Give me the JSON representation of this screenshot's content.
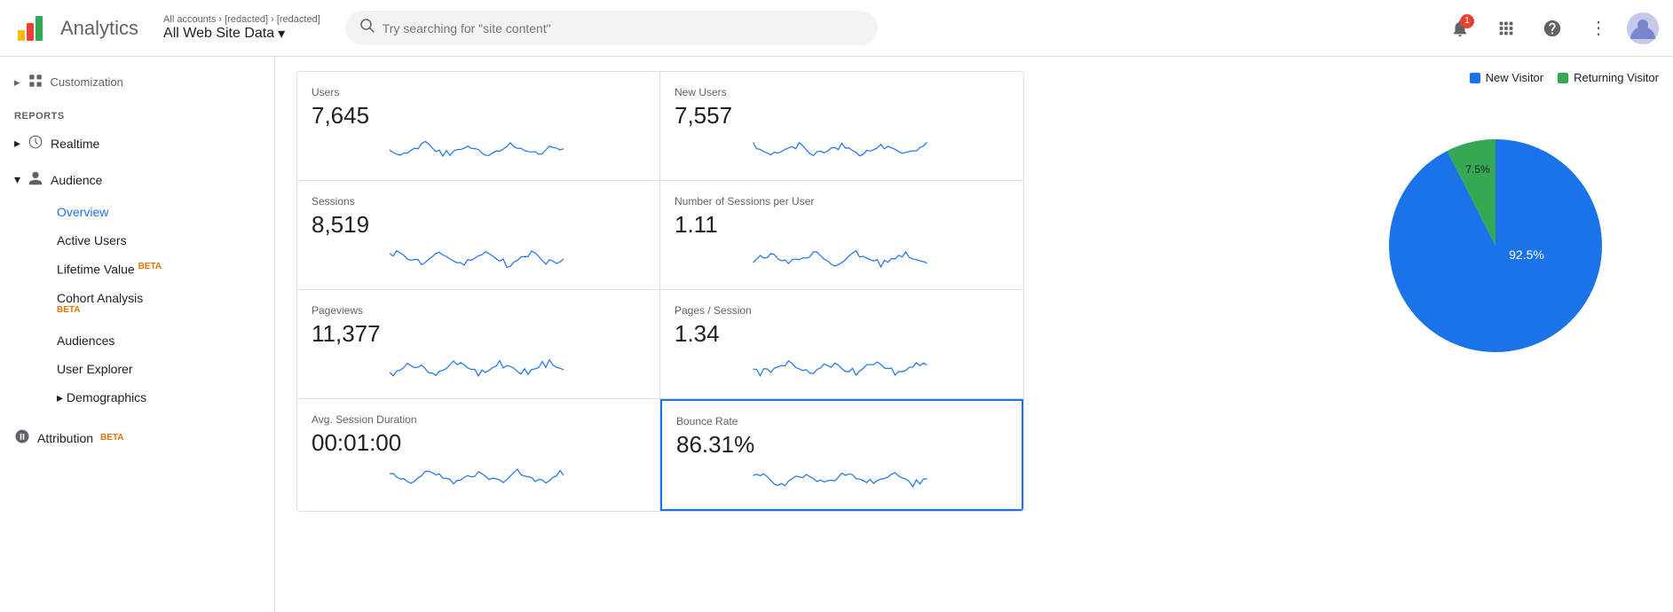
{
  "topbar": {
    "app_name": "Analytics",
    "breadcrumb": "All accounts › [redacted] › [redacted]",
    "account_name": "All Web Site Data",
    "search_placeholder": "Try searching for \"site content\"",
    "notif_count": "1"
  },
  "sidebar": {
    "customization_label": "Customization",
    "reports_label": "REPORTS",
    "realtime_label": "Realtime",
    "audience_label": "Audience",
    "overview_label": "Overview",
    "active_users_label": "Active Users",
    "lifetime_value_label": "Lifetime Value",
    "lifetime_value_beta": "BETA",
    "cohort_analysis_label": "Cohort Analysis",
    "cohort_analysis_beta": "BETA",
    "audiences_label": "Audiences",
    "user_explorer_label": "User Explorer",
    "demographics_label": "Demographics",
    "attribution_label": "Attribution",
    "attribution_beta": "BETA"
  },
  "metrics": [
    {
      "label": "Users",
      "value": "7,645",
      "id": "users"
    },
    {
      "label": "New Users",
      "value": "7,557",
      "id": "new-users"
    },
    {
      "label": "Sessions",
      "value": "8,519",
      "id": "sessions"
    },
    {
      "label": "Number of Sessions per User",
      "value": "1.11",
      "id": "sessions-per-user"
    },
    {
      "label": "Pageviews",
      "value": "11,377",
      "id": "pageviews"
    },
    {
      "label": "Pages / Session",
      "value": "1.34",
      "id": "pages-per-session"
    },
    {
      "label": "Avg. Session Duration",
      "value": "00:01:00",
      "id": "avg-session"
    },
    {
      "label": "Bounce Rate",
      "value": "86.31%",
      "id": "bounce-rate",
      "highlighted": true
    }
  ],
  "chart": {
    "legend": [
      {
        "label": "New Visitor",
        "color": "#1a73e8"
      },
      {
        "label": "Returning Visitor",
        "color": "#34a853"
      }
    ],
    "new_visitor_pct": "92.5",
    "returning_visitor_pct": "7.5",
    "new_visitor_color": "#1a73e8",
    "returning_visitor_color": "#34a853"
  },
  "icons": {
    "search": "🔍",
    "bell": "🔔",
    "grid": "⊞",
    "help": "?",
    "more": "⋮",
    "chevron_right": "›",
    "chevron_down": "▾",
    "clock": "◷",
    "person": "👤",
    "shield": "⬡",
    "expand": "▸"
  }
}
